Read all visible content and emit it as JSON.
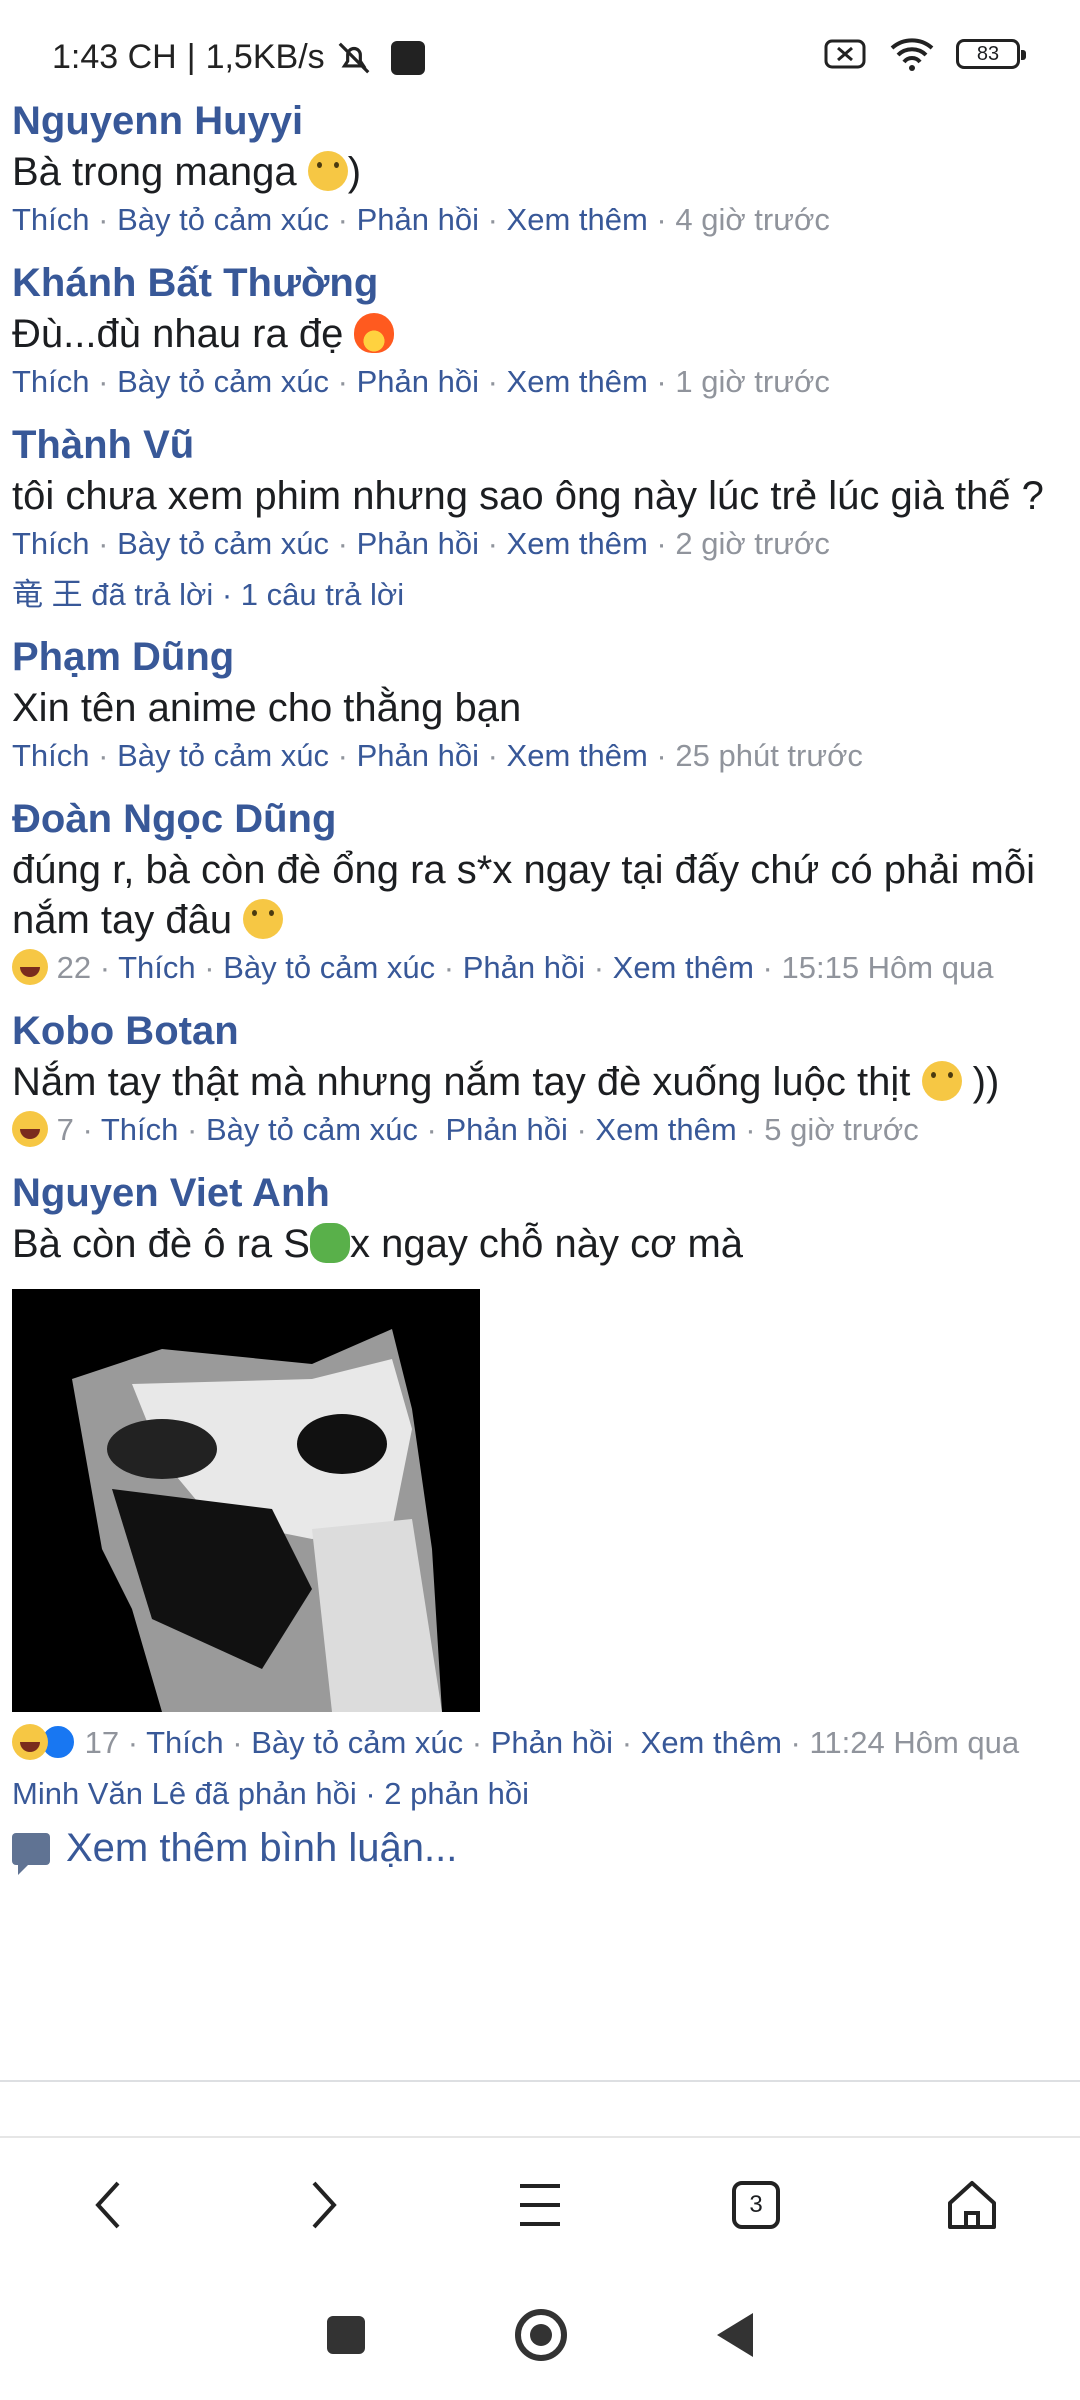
{
  "status_bar": {
    "time": "1:43 CH",
    "speed": "1,5KB/s",
    "battery": "83"
  },
  "comments": [
    {
      "author": "Nguyenn Huyyi",
      "text": "Bà trong manga",
      "text_suffix": ")",
      "emoji": "smile",
      "actions": [
        "Thích",
        "Bày tỏ cảm xúc",
        "Phản hồi",
        "Xem thêm"
      ],
      "time": "4 giờ trước"
    },
    {
      "author": "Khánh Bất Thường",
      "text": "Đù...đù nhau ra đẹ",
      "emoji": "fire",
      "actions": [
        "Thích",
        "Bày tỏ cảm xúc",
        "Phản hồi",
        "Xem thêm"
      ],
      "time": "1 giờ trước"
    },
    {
      "author": "Thành Vũ",
      "text": "tôi chưa xem phim nhưng sao ông này lúc trẻ lúc già thế ?",
      "actions": [
        "Thích",
        "Bày tỏ cảm xúc",
        "Phản hồi",
        "Xem thêm"
      ],
      "time": "2 giờ trước",
      "replies": "竜 王 đã trả lời · 1 câu trả lời"
    },
    {
      "author": "Phạm Dũng",
      "text": "Xin tên anime cho thằng bạn",
      "actions": [
        "Thích",
        "Bày tỏ cảm xúc",
        "Phản hồi",
        "Xem thêm"
      ],
      "time": "25 phút trước"
    },
    {
      "author": "Đoàn Ngọc Dũng",
      "text": "đúng r, bà còn đè ổng ra s*x ngay tại đấy chứ có phải mỗi nắm tay đâu",
      "emoji": "smile",
      "reaction_count": "22",
      "actions": [
        "Thích",
        "Bày tỏ cảm xúc",
        "Phản hồi",
        "Xem thêm"
      ],
      "time": "15:15 Hôm qua"
    },
    {
      "author": "Kobo Botan",
      "text": "Nắm tay thật mà nhưng nắm tay đè xuống luộc thịt",
      "text_suffix": "))",
      "emoji": "smile",
      "reaction_count": "7",
      "actions": [
        "Thích",
        "Bày tỏ cảm xúc",
        "Phản hồi",
        "Xem thêm"
      ],
      "time": "5 giờ trước"
    },
    {
      "author": "Nguyen Viet Anh",
      "text_a": "Bà còn đè ô ra S",
      "text_b": "x ngay chỗ này cơ mà",
      "emoji": "frog",
      "reaction_count": "17",
      "actions": [
        "Thích",
        "Bày tỏ cảm xúc",
        "Phản hồi",
        "Xem thêm"
      ],
      "time": "11:24 Hôm qua",
      "replies": "Minh Văn Lê đã phản hồi · 2 phản hồi"
    }
  ],
  "more_comments": "Xem thêm bình luận...",
  "browser_bar": {
    "tabs_count": "3"
  }
}
